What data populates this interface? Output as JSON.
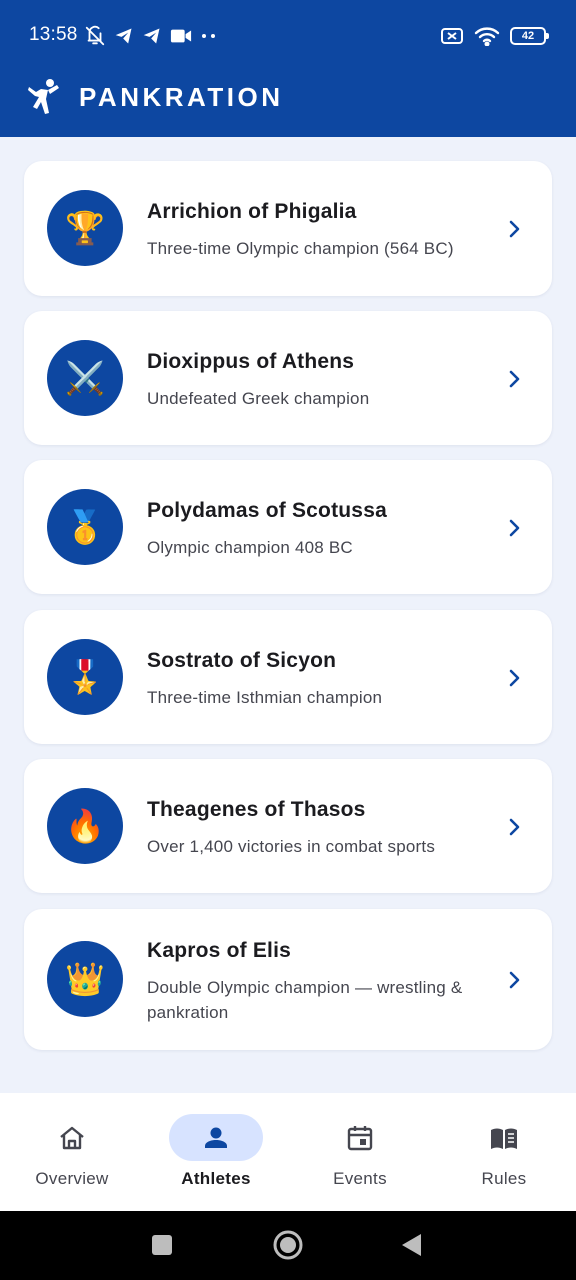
{
  "status_bar": {
    "time": "13:58",
    "left_icons": [
      "vibrate-off-icon",
      "telegram-icon",
      "telegram-icon",
      "video-camera-icon",
      "more-dots-icon"
    ],
    "right_icons": [
      "sim-off-icon",
      "wifi-icon",
      "battery-icon"
    ],
    "battery_level": "42"
  },
  "app_bar": {
    "title": "PANKRATION",
    "logo_icon": "martial-arts-kick-icon"
  },
  "athletes": [
    {
      "name": "Arrichion of Phigalia",
      "description": "Three-time Olympic champion (564 BC)",
      "emoji": "🏆",
      "icon": "trophy-icon"
    },
    {
      "name": "Dioxippus of Athens",
      "description": "Undefeated Greek champion",
      "emoji": "⚔️",
      "icon": "crossed-swords-icon"
    },
    {
      "name": "Polydamas of Scotussa",
      "description": "Olympic champion 408 BC",
      "emoji": "🥇",
      "icon": "gold-medal-icon"
    },
    {
      "name": "Sostrato of Sicyon",
      "description": "Three-time Isthmian champion",
      "emoji": "🎖️",
      "icon": "military-medal-icon"
    },
    {
      "name": "Theagenes of Thasos",
      "description": "Over 1,400 victories in combat sports",
      "emoji": "🔥",
      "icon": "fire-icon"
    },
    {
      "name": "Kapros of Elis",
      "description": "Double Olympic champion — wrestling & pankration",
      "emoji": "👑",
      "icon": "crown-icon"
    }
  ],
  "bottom_nav": {
    "selected": "Athletes",
    "items": [
      {
        "label": "Overview",
        "icon": "home-icon"
      },
      {
        "label": "Athletes",
        "icon": "person-icon"
      },
      {
        "label": "Events",
        "icon": "calendar-icon"
      },
      {
        "label": "Rules",
        "icon": "book-icon"
      }
    ]
  },
  "system_nav": [
    "recents-square-icon",
    "home-circle-icon",
    "back-triangle-icon"
  ],
  "colors": {
    "primary": "#0d47a1",
    "background": "#eef2fb",
    "card": "#ffffff",
    "nav_selected_pill": "#d7e3ff",
    "title_text": "#1b1b1f",
    "secondary_text": "#45464f"
  }
}
